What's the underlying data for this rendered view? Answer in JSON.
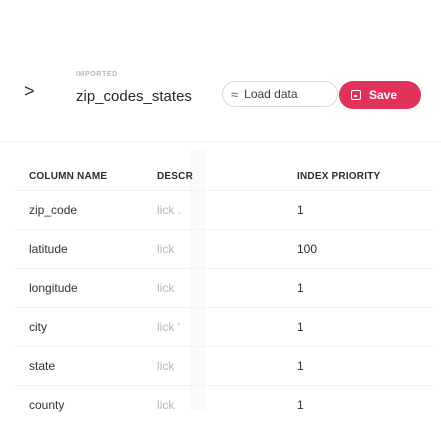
{
  "header": {
    "chevron": ">",
    "imported_label": "IMPORTED",
    "title": "zip_codes_states",
    "load_icon": "database-icon",
    "load_label": "Load data",
    "save_icon": "save-icon",
    "save_label": "Save",
    "accent_color": "#e0325a"
  },
  "table": {
    "headers": [
      "COLUMN NAME",
      "DESCR",
      "INDEX PRIORITY"
    ],
    "rows": [
      {
        "name": "zip_code",
        "desc": "lick .",
        "priority": "1"
      },
      {
        "name": "latitude",
        "desc": "lick",
        "priority": "100"
      },
      {
        "name": "longitude",
        "desc": "lick  ",
        "priority": "1"
      },
      {
        "name": "city",
        "desc": "lick '",
        "priority": "1"
      },
      {
        "name": "state",
        "desc": "lick  ",
        "priority": "1"
      },
      {
        "name": "county",
        "desc": "lick",
        "priority": "1"
      }
    ]
  }
}
